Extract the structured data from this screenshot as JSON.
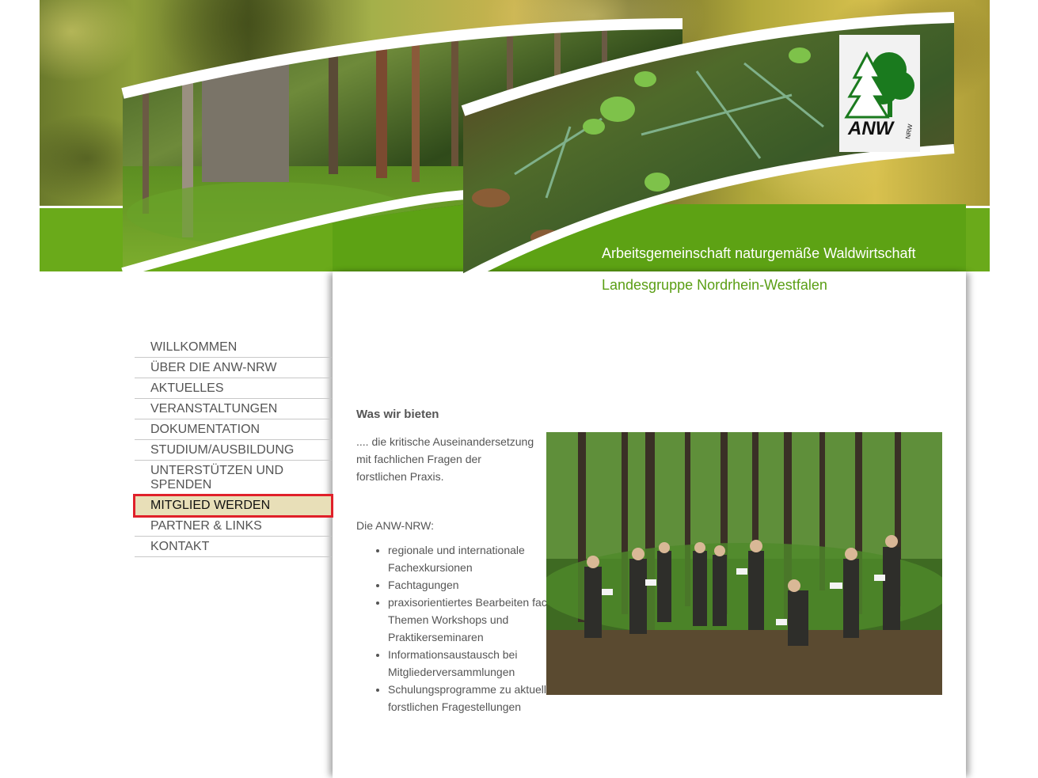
{
  "header": {
    "title": "Arbeitsgemeinschaft naturgemäße Waldwirtschaft",
    "subtitle": "Landesgruppe Nordrhein-Westfalen",
    "logo_text": "ANW",
    "logo_sub": "NRW"
  },
  "nav": {
    "items": [
      {
        "label": "WILLKOMMEN"
      },
      {
        "label": "ÜBER DIE ANW-NRW"
      },
      {
        "label": "AKTUELLES"
      },
      {
        "label": "VERANSTALTUNGEN"
      },
      {
        "label": "DOKUMENTATION"
      },
      {
        "label": "STUDIUM/AUSBILDUNG"
      },
      {
        "label": "UNTERSTÜTZEN UND SPENDEN"
      },
      {
        "label": "MITGLIED WERDEN"
      },
      {
        "label": "PARTNER & LINKS"
      },
      {
        "label": "KONTAKT"
      }
    ],
    "active_index": 7
  },
  "content": {
    "heading": "Was wir bieten",
    "intro": ".... die kritische Auseinandersetzung mit fachlichen Fragen der forstlichen Praxis.",
    "lead": "Die ANW-NRW:",
    "offers": [
      "regionale und internationale Fachexkursionen",
      "Fachtagungen",
      "praxisorientiertes Bearbeiten fachlicher Themen Workshops und Praktikerseminaren",
      "Informationsaustausch bei Mitgliederversammlungen",
      "Schulungsprogramme zu aktuellen forstlichen Fragestellungen"
    ]
  },
  "colors": {
    "accent_green": "#5da214",
    "active_bg": "#e8dfb8",
    "highlight_border": "#e0202a"
  }
}
